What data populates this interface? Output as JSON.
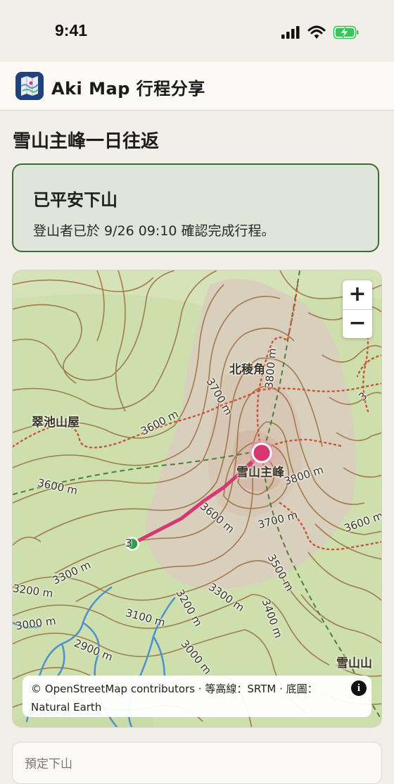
{
  "status_bar": {
    "time": "9:41"
  },
  "header": {
    "app_name": "Aki Map 行程分享"
  },
  "trip": {
    "title": "雪山主峰一日往返"
  },
  "status_card": {
    "heading": "已平安下山",
    "description": "登山者已於 9/26 09:10 確認完成行程。"
  },
  "map": {
    "labels": {
      "beiling": "北稜角",
      "cuichi": "翠池山屋",
      "xueshan_main": "雪山主峰",
      "xueshan_edge": "雪山山"
    },
    "contours": {
      "c3600a": "3600 m",
      "c3600b": "3600 m",
      "c3600c": "3600 m",
      "c3600d": "3600 m",
      "c3700a": "3700 m",
      "c3700b": "3700 m",
      "c3800a": "3800 m",
      "c3800b": "3800 m",
      "c3500": "3500 m",
      "c3400": "3400 m",
      "c3300a": "3300 m",
      "c3300b": "3300 m",
      "c3200a": "3200 m",
      "c3200b": "3200 m",
      "c3100": "3100 m",
      "c3000a": "3000 m",
      "c3000b": "3000 m",
      "c2900": "2900 m",
      "c3_partial": "3",
      "c3_partial2": "3"
    },
    "zoom_in": "+",
    "zoom_out": "−",
    "attribution": "© OpenStreetMap contributors · 等高線：SRTM · 底圖：Natural Earth",
    "info": "i",
    "colors": {
      "route": "#d63872",
      "start": "#2e9e48",
      "trail": "#c9583a",
      "boundary": "#4c7d3a",
      "stream": "#4f8fca"
    }
  },
  "next_card": {
    "label": "預定下山"
  }
}
